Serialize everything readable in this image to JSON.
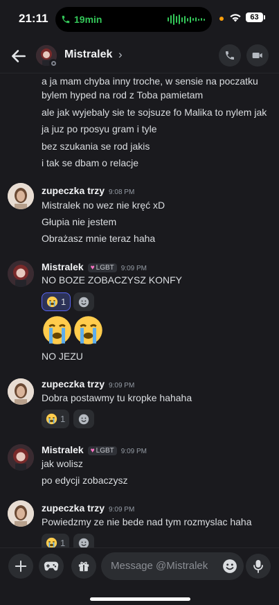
{
  "status_bar": {
    "time": "21:11",
    "call_duration": "19min",
    "battery": "63"
  },
  "header": {
    "name": "Mistralek",
    "chevron": "›",
    "back_icon": "arrow-left-icon",
    "call_icon": "phone-icon",
    "video_icon": "video-icon"
  },
  "messages": {
    "m1_lines": [
      "a ja mam chyba inny troche, w sensie na poczatku",
      "bylem hyped na rod z Toba pamietam",
      "ale jak wyjebaly sie te sojsuze fo Malika to nylem jak",
      "ja juz po rposyu gram i tyle",
      "bez szukania se rod jakis",
      "i tak se dbam o relacje"
    ],
    "g2": {
      "author": "zupeczka trzy",
      "time": "9:08 PM",
      "lines": [
        "Mistralek no wez nie kręć xD",
        "Głupia nie jestem",
        "Obrażasz mnie teraz haha"
      ]
    },
    "g3": {
      "author": "Mistralek",
      "tag": "LGBT",
      "time": "9:09 PM",
      "line1": "NO BOZE ZOBACZYSZ KONFY",
      "reaction_count": "1",
      "line2": "NO JEZU"
    },
    "g4": {
      "author": "zupeczka trzy",
      "time": "9:09 PM",
      "line": "Dobra postawmy tu kropke hahaha",
      "reaction_count": "1"
    },
    "g5": {
      "author": "Mistralek",
      "tag": "LGBT",
      "time": "9:09 PM",
      "lines": [
        "jak wolisz",
        "po edycji zobaczysz"
      ]
    },
    "g6": {
      "author": "zupeczka trzy",
      "time": "9:09 PM",
      "line": "Powiedzmy ze nie bede nad tym rozmyslac haha",
      "reaction_count": "1"
    }
  },
  "composer": {
    "placeholder": "Message @Mistralek"
  },
  "colors": {
    "background": "#1a1a1e",
    "surface": "#2b2d31",
    "accent": "#5865f2",
    "call_green": "#34c759"
  }
}
